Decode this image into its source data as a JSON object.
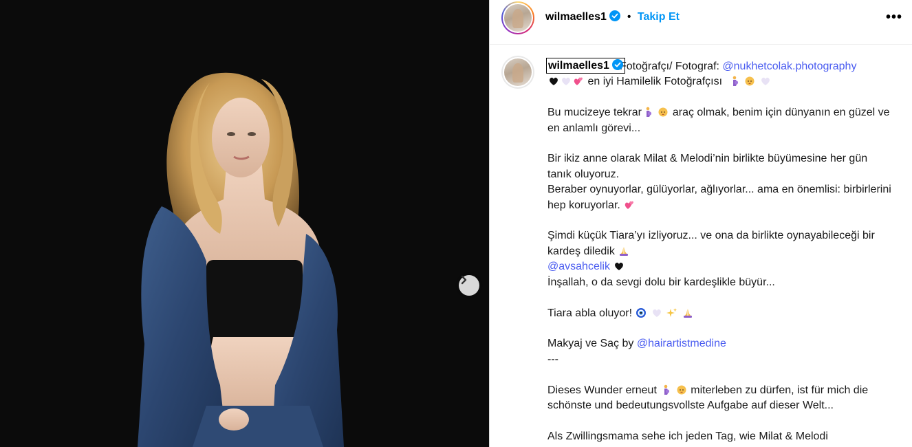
{
  "post": {
    "username": "wilmaelles1",
    "separator": "•",
    "follow_label": "Takip Et",
    "more_label": "•••"
  },
  "caption": {
    "username": "wilmaelles1",
    "line1": "Fotoğrafçı/ Fotograf: ",
    "mention1": "@nukhetcolak.photography",
    "line2_text": "en iyi Hamilelik Fotoğrafçısı",
    "p1a": "Bu mucizeye tekrar",
    "p1b": "araç olmak, benim için dünyanın en güzel ve en anlamlı görevi...",
    "p2a": "Bir ikiz anne olarak Milat & Melodi’nin birlikte büyümesine her gün tanık oluyoruz.",
    "p2b": "Beraber oynuyorlar, gülüyorlar, ağlıyorlar... ama en önemlisi: birbirlerini hep koruyorlar.",
    "p3a": "Şimdi küçük Tiara’yı izliyoruz... ve ona da birlikte oynayabileceği bir kardeş diledik",
    "mention2": "@avsahcelik",
    "p3b": "İnşallah, o da sevgi dolu bir kardeşlikle büyür...",
    "p4": "Tiara abla oluyor!",
    "p5a": "Makyaj ve Saç by ",
    "mention3": "@hairartistmedine",
    "p5b": "---",
    "p6a": "Dieses Wunder erneut",
    "p6b": "miterleben zu dürfen, ist für mich die schönste und bedeutungsvollste Aufgabe auf dieser Welt...",
    "p7": "Als Zwillingsmama sehe ich jeden Tag, wie Milat & Melodi"
  },
  "icons": {
    "verified": "verified-badge-icon",
    "next": "chevron-right-icon",
    "more": "more-options-icon"
  },
  "colors": {
    "link": "#4a5cf0",
    "follow": "#0095f6",
    "verified": "#0095f6",
    "media_bg": "#0b0b0b"
  }
}
